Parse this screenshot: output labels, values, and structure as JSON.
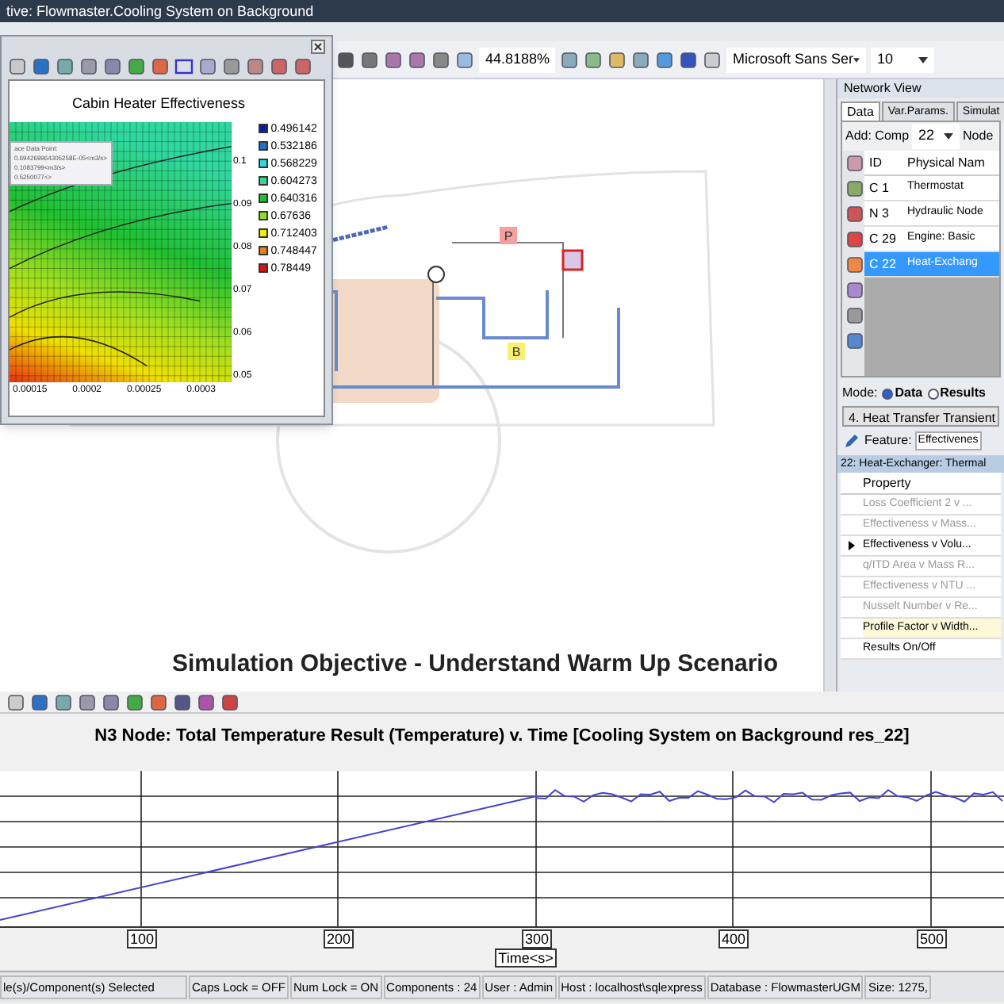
{
  "window": {
    "title": "tive: Flowmaster.Cooling System on Background"
  },
  "toolbar": {
    "zoom": "44.8188%",
    "font": "Microsoft Sans Ser",
    "font_size": "10"
  },
  "chart_window": {
    "title": "Cabin Heater Effectiveness",
    "tooltip": [
      "ace Data Point:",
      "0.694269964305258E-05<m3/s>",
      "0.1083799<m3/s>",
      "0.5250077<>"
    ],
    "legend": [
      {
        "label": "0.496142",
        "color": "#0a1aa8"
      },
      {
        "label": "0.532186",
        "color": "#1e6fd0"
      },
      {
        "label": "0.568229",
        "color": "#2cd8e0"
      },
      {
        "label": "0.604273",
        "color": "#30d890"
      },
      {
        "label": "0.640316",
        "color": "#20c030"
      },
      {
        "label": "0.67636",
        "color": "#90e020"
      },
      {
        "label": "0.712403",
        "color": "#f0f000"
      },
      {
        "label": "0.748447",
        "color": "#f08010"
      },
      {
        "label": "0.78449",
        "color": "#e01010"
      }
    ],
    "xticks": [
      "0.00015",
      "0.0002",
      "0.00025",
      "0.0003"
    ],
    "yticks": [
      "0.1",
      "0.09",
      "0.08",
      "0.07",
      "0.06",
      "0.05"
    ]
  },
  "diagram": {
    "markers": [
      {
        "label": "P",
        "color": "#f4a0a0"
      },
      {
        "label": "B",
        "color": "#f8f070"
      }
    ],
    "caption": "Simulation Objective - Understand Warm Up Scenario"
  },
  "network_view": {
    "title": "Network View",
    "tabs": [
      {
        "label": "Data",
        "selected": true
      },
      {
        "label": "Var.Params.",
        "selected": false
      },
      {
        "label": "Simulat",
        "selected": false
      }
    ],
    "add_label": "Add: Comp",
    "add_value": "22",
    "node_label": "Node",
    "columns": [
      "ID",
      "Physical Nam"
    ],
    "rows": [
      {
        "id": "C  1",
        "name": "Thermostat",
        "selected": false
      },
      {
        "id": "N  3",
        "name": "Hydraulic Node",
        "selected": false
      },
      {
        "id": "C  29",
        "name": "Engine: Basic",
        "selected": false
      },
      {
        "id": "C  22",
        "name": "Heat-Exchang",
        "selected": true
      }
    ],
    "mode_label": "Mode:",
    "modes": [
      {
        "label": "Data",
        "selected": true
      },
      {
        "label": "Results",
        "selected": false
      }
    ],
    "analysis": "4. Heat Transfer Transient",
    "feature_label": "Feature:",
    "feature_value": "Effectivenes",
    "header": "22: Heat-Exchanger: Thermal",
    "property_column": "Property",
    "properties": [
      {
        "label": "Loss Coefficient 2 v ...",
        "disabled": true,
        "selected": false,
        "highlighted": false
      },
      {
        "label": "Effectiveness v Mass...",
        "disabled": true,
        "selected": false,
        "highlighted": false
      },
      {
        "label": "Effectiveness v Volu...",
        "disabled": false,
        "selected": true,
        "highlighted": false
      },
      {
        "label": "q/ITD Area v Mass R...",
        "disabled": true,
        "selected": false,
        "highlighted": false
      },
      {
        "label": "Effectiveness v NTU ...",
        "disabled": true,
        "selected": false,
        "highlighted": false
      },
      {
        "label": "Nusselt Number v Re...",
        "disabled": true,
        "selected": false,
        "highlighted": false
      },
      {
        "label": "Profile Factor v Width...",
        "disabled": false,
        "selected": false,
        "highlighted": true
      },
      {
        "label": "Results On/Off",
        "disabled": false,
        "selected": false,
        "highlighted": false
      }
    ]
  },
  "result_chart": {
    "title": "N3 Node: Total Temperature Result (Temperature) v. Time [Cooling System on Background res_22]",
    "xticks": [
      "100",
      "200",
      "300",
      "400",
      "500"
    ],
    "xlabel": "Time<s>"
  },
  "status_bar": [
    "le(s)/Component(s) Selected",
    "Caps Lock = OFF",
    "Num Lock = ON",
    "Components : 24",
    "User : Admin",
    "Host : localhost\\sqlexpress",
    "Database : FlowmasterUGM",
    "Size: 1275,"
  ]
}
